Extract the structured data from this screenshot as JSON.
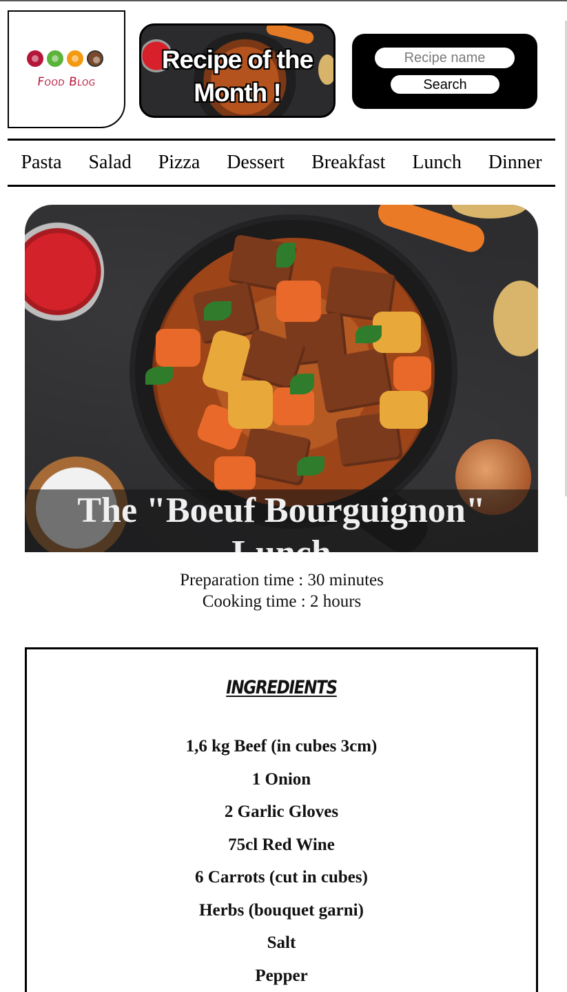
{
  "header": {
    "logo_text": "Food Blog",
    "recipe_of_month_title": "Recipe of the Month !",
    "search": {
      "placeholder": "Recipe name",
      "button_label": "Search"
    }
  },
  "nav": {
    "items": [
      "Pasta",
      "Salad",
      "Pizza",
      "Dessert",
      "Breakfast",
      "Lunch",
      "Dinner"
    ]
  },
  "hero": {
    "title": "The \"Boeuf Bourguignon\" Lunch"
  },
  "times": {
    "preparation": "Preparation time : 30 minutes",
    "cooking": "Cooking time : 2 hours"
  },
  "ingredients": {
    "heading": "INGREDIENTS",
    "items": [
      "1,6 kg Beef (in cubes 3cm)",
      "1 Onion",
      "2 Garlic Gloves",
      "75cl Red Wine",
      "6 Carrots (cut in cubes)",
      "Herbs (bouquet garni)",
      "Salt",
      "Pepper"
    ]
  }
}
